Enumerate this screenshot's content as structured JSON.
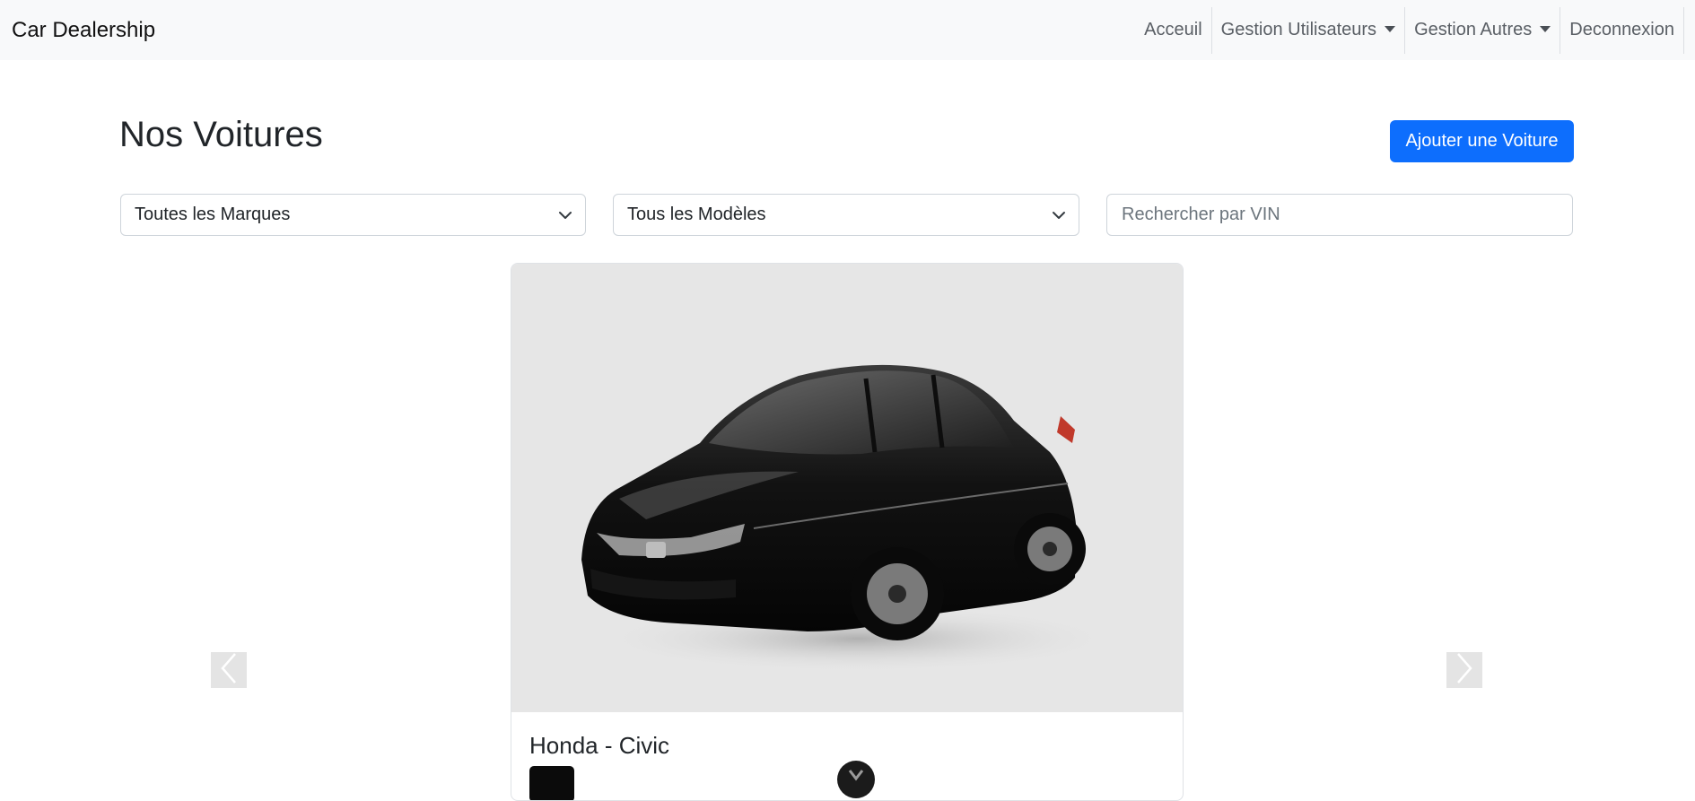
{
  "navbar": {
    "brand": "Car Dealership",
    "links": [
      {
        "label": "Acceuil",
        "dropdown": false
      },
      {
        "label": "Gestion Utilisateurs",
        "dropdown": true
      },
      {
        "label": "Gestion Autres",
        "dropdown": true
      },
      {
        "label": "Deconnexion",
        "dropdown": false
      }
    ]
  },
  "page": {
    "title": "Nos Voitures",
    "add_button": "Ajouter une Voiture"
  },
  "filters": {
    "brand_select": "Toutes les Marques",
    "model_select": "Tous les Modèles",
    "search_placeholder": "Rechercher par VIN"
  },
  "carousel": {
    "cards": [
      {
        "title": "Honda - Civic",
        "car_color": "#0b0b0b"
      }
    ],
    "prev_icon": "chevron-left-icon",
    "next_icon": "chevron-right-icon"
  },
  "colors": {
    "primary": "#0d6efd",
    "navbar_bg": "#f8f9fa",
    "image_bg": "#e6e6e6"
  }
}
